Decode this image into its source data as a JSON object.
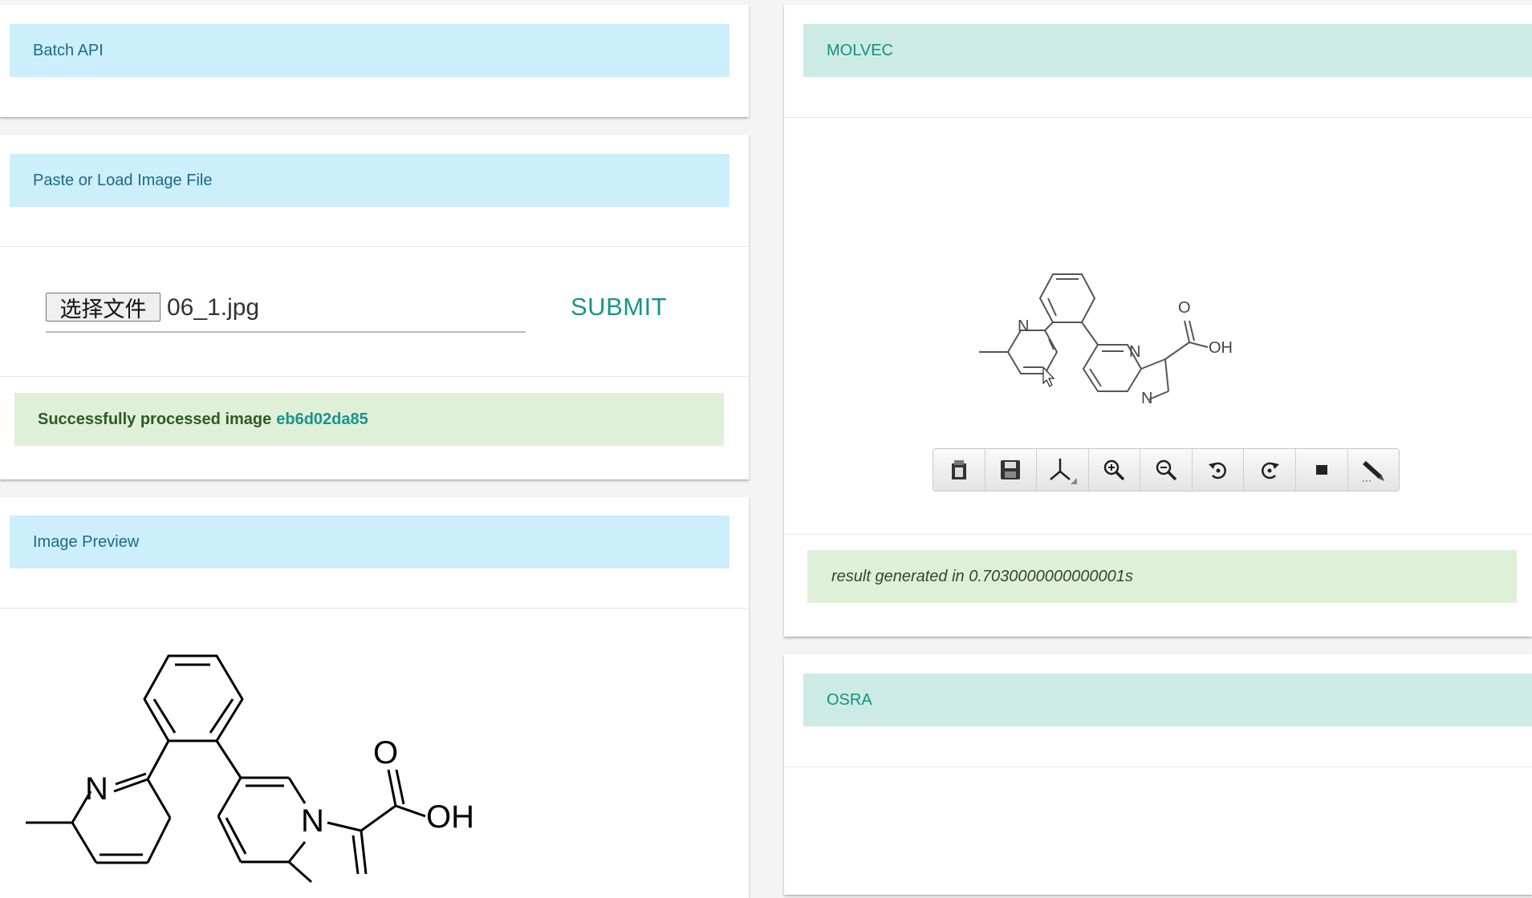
{
  "left": {
    "batch_api": {
      "title": "Batch API"
    },
    "load_image": {
      "title": "Paste or Load Image File",
      "file_button_label": "选择文件",
      "file_name": "06_1.jpg",
      "submit_label": "SUBMIT",
      "status_text": "Successfully processed image",
      "status_hash": "eb6d02da85"
    },
    "preview": {
      "title": "Image Preview",
      "atoms": {
        "N1": "N",
        "N2": "N",
        "O": "O",
        "OH": "OH"
      }
    }
  },
  "right": {
    "molvec": {
      "title": "MOLVEC",
      "result_text": "result generated in 0.7030000000000001s",
      "atoms": {
        "N1": "N",
        "N2": "N",
        "N3": "N",
        "O": "O",
        "OH": "OH"
      },
      "toolbar": [
        {
          "icon": "clipboard-icon"
        },
        {
          "icon": "save-icon"
        },
        {
          "icon": "3d-axis-icon"
        },
        {
          "icon": "zoom-in-icon"
        },
        {
          "icon": "zoom-out-icon"
        },
        {
          "icon": "rotate-ccw-icon"
        },
        {
          "icon": "rotate-cw-icon"
        },
        {
          "icon": "stop-icon"
        },
        {
          "icon": "edit-pen-icon"
        }
      ]
    },
    "osra": {
      "title": "OSRA"
    }
  },
  "colors": {
    "header_blue": "#cdeefb",
    "header_teal": "#cdebe5",
    "accent": "#17948a",
    "success_bg": "#dff0d8"
  }
}
